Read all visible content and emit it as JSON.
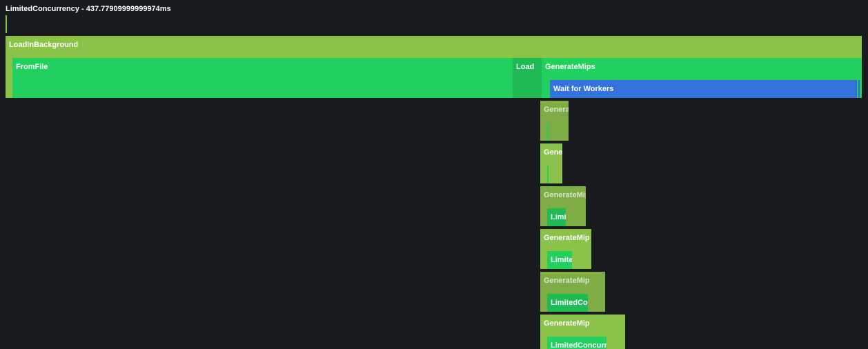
{
  "header": {
    "title": "LimitedConcurrency - 437.77909999999974ms"
  },
  "spans": {
    "load_in_background": "LoadInBackground",
    "from_file": "FromFile",
    "load": "Load",
    "generate_mips": "GenerateMips",
    "wait_for_workers": "Wait for Workers"
  },
  "children": [
    {
      "label": "GenerateMip",
      "child_label": ""
    },
    {
      "label": "GenerateMip",
      "child_label": ""
    },
    {
      "label": "GenerateMip",
      "child_label": "LimitedConcurrency"
    },
    {
      "label": "GenerateMip",
      "child_label": "LimitedConcurrency"
    },
    {
      "label": "GenerateMip",
      "child_label": "LimitedConcurrency"
    },
    {
      "label": "GenerateMip",
      "child_label": "LimitedConcurrency"
    }
  ],
  "colors": {
    "background": "#181b1e",
    "light_green": "#8bc34a",
    "green": "#22d05f",
    "blue": "#3573dc"
  }
}
